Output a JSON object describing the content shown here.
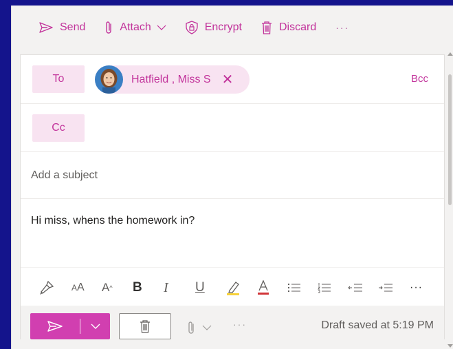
{
  "commands": {
    "send": "Send",
    "attach": "Attach",
    "encrypt": "Encrypt",
    "discard": "Discard",
    "more": "···"
  },
  "recipients": {
    "to_label": "To",
    "cc_label": "Cc",
    "bcc_label": "Bcc",
    "to_chip_name": "Hatfield , Miss S",
    "remove_glyph": "✕"
  },
  "subject": {
    "placeholder": "Add a subject"
  },
  "message": {
    "body": "Hi miss, whens the homework in?"
  },
  "format_toolbar": {
    "more": "···",
    "icons": [
      "format-painter-icon",
      "font-size-icon",
      "grow-font-icon",
      "bold-icon",
      "italic-icon",
      "underline-icon",
      "highlight-icon",
      "font-color-icon",
      "bullets-icon",
      "numbering-icon",
      "decrease-indent-icon",
      "increase-indent-icon",
      "more-icon"
    ]
  },
  "footer": {
    "status": "Draft saved at 5:19 PM",
    "more": "···"
  },
  "colors": {
    "accent": "#c2339b",
    "send_button": "#d13fb0",
    "chip_bg": "#f8e3f1",
    "background": "#14148c"
  }
}
